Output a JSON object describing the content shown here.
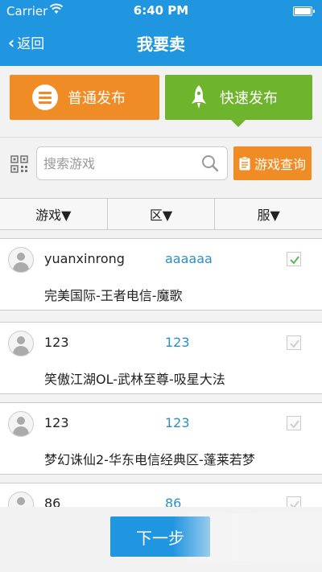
{
  "status_bar": {
    "carrier": "Carrier",
    "time": "6:40 PM"
  },
  "nav": {
    "back_label": "返回",
    "title": "我要卖"
  },
  "publish": {
    "normal_label": "普通发布",
    "fast_label": "快速发布",
    "active": "fast"
  },
  "search": {
    "placeholder": "搜索游戏",
    "value": "",
    "query_button": "游戏查询"
  },
  "filters": [
    {
      "label": "游戏▼"
    },
    {
      "label": "区▼"
    },
    {
      "label": "服▼"
    }
  ],
  "items": [
    {
      "user": "yuanxinrong",
      "zone": "aaaaaa",
      "game": "完美国际-王者电信-魔歌",
      "checked": true
    },
    {
      "user": "123",
      "zone": "123",
      "game": "笑傲江湖OL-武林至尊-吸星大法",
      "checked": false
    },
    {
      "user": "123",
      "zone": "123",
      "game": "梦幻诛仙2-华东电信经典区-蓬莱若梦",
      "checked": false
    },
    {
      "user": "86",
      "zone": "86",
      "game": "",
      "checked": false
    }
  ],
  "footer": {
    "next_label": "下一步"
  },
  "colors": {
    "nav_blue": "#2196e0",
    "orange": "#f08c25",
    "green": "#6eb42c",
    "zone_blue": "#2a8fc8",
    "check_green": "#5cb85c"
  }
}
